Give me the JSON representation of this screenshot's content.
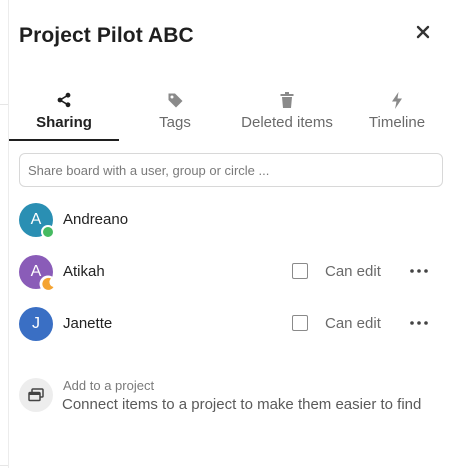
{
  "header": {
    "title": "Project Pilot ABC",
    "close_icon": "close-icon"
  },
  "tabs": [
    {
      "label": "Sharing",
      "icon": "share-icon",
      "active": true
    },
    {
      "label": "Tags",
      "icon": "tag-icon",
      "active": false
    },
    {
      "label": "Deleted items",
      "icon": "trash-icon",
      "active": false
    },
    {
      "label": "Timeline",
      "icon": "lightning-icon",
      "active": false
    }
  ],
  "share": {
    "placeholder": "Share board with a user, group or circle ..."
  },
  "users": [
    {
      "initial": "A",
      "name": "Andreano",
      "avatar_color": "#2a8fb3",
      "status": "online",
      "status_color": "#46ba61",
      "show_permissions": false
    },
    {
      "initial": "A",
      "name": "Atikah",
      "avatar_color": "#8a5cb8",
      "status": "away",
      "status_color": "#f4a331",
      "show_permissions": true,
      "permission_label": "Can edit",
      "can_edit": false
    },
    {
      "initial": "J",
      "name": "Janette",
      "avatar_color": "#3a6fc4",
      "status": "none",
      "show_permissions": true,
      "permission_label": "Can edit",
      "can_edit": false
    }
  ],
  "project": {
    "title": "Add to a project",
    "subtitle": "Connect items to a project to make them easier to find",
    "icon": "project-icon"
  },
  "colors": {
    "text": "#222222",
    "muted": "#6a6a6a",
    "border": "#d8d8d8"
  }
}
